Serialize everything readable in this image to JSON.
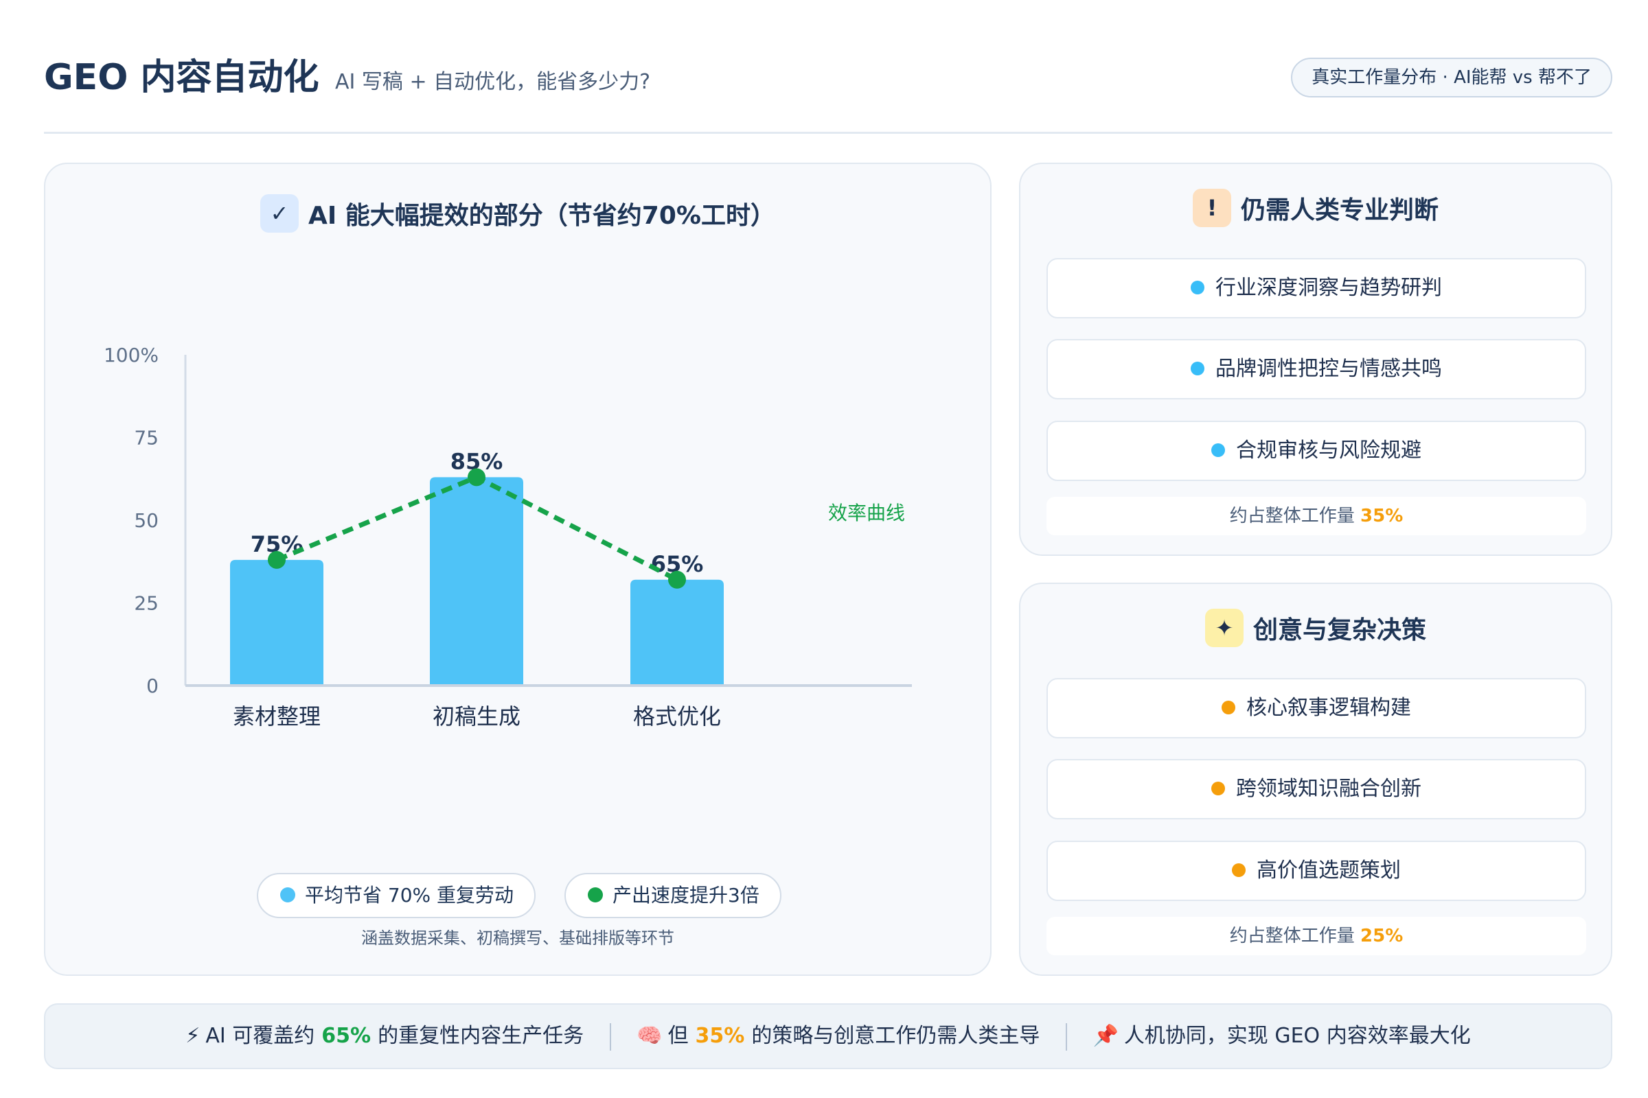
{
  "header": {
    "title": "GEO 内容自动化",
    "subtitle": "AI 写稿 + 自动优化，能省多少力?",
    "badge": "真实工作量分布 · AI能帮 vs 帮不了"
  },
  "left_panel": {
    "icon": "check-icon",
    "icon_glyph": "✓",
    "title": "AI 能大幅提效的部分（节省约70%工时）",
    "legend": [
      {
        "label": "平均节省 70% 重复劳动",
        "color": "#4fc3f7"
      },
      {
        "label": "产出速度提升3倍",
        "color": "#16a34a"
      }
    ],
    "note": "涵盖数据采集、初稿撰写、基础排版等环节"
  },
  "chart_data": {
    "type": "bar",
    "categories": [
      "素材整理",
      "初稿生成",
      "格式优化"
    ],
    "values": [
      38,
      63,
      32
    ],
    "data_labels": [
      "75%",
      "85%",
      "65%"
    ],
    "y_ticks": [
      "0",
      "25",
      "50",
      "75",
      "100%"
    ],
    "ylim": [
      0,
      100
    ],
    "bar_color": "#4fc3f7",
    "series": [
      {
        "name": "效率曲线",
        "values": [
          38,
          63,
          32
        ],
        "color": "#16a34a",
        "style": "dashed-line"
      }
    ],
    "grid": false,
    "legend": "right"
  },
  "right_panel_1": {
    "icon": "exclamation-icon",
    "icon_glyph": "!",
    "icon_bg": "#fde0c0",
    "title": "仍需人类专业判断",
    "dot_color": "#38bdf8",
    "items": [
      "行业深度洞察与趋势研判",
      "品牌调性把控与情感共鸣",
      "合规审核与风险规避"
    ],
    "share_prefix": "约占整体工作量",
    "share_value": "35%",
    "share_color": "#f59e0b"
  },
  "right_panel_2": {
    "icon": "sparkle-icon",
    "icon_glyph": "✦",
    "icon_bg": "#fdf0a8",
    "title": "创意与复杂决策",
    "dot_color": "#f59e0b",
    "items": [
      "核心叙事逻辑构建",
      "跨领域知识融合创新",
      "高价值选题策划"
    ],
    "share_prefix": "约占整体工作量",
    "share_value": "25%",
    "share_color": "#f59e0b"
  },
  "footer": {
    "part1_icon": "⚡",
    "part1_pre": "AI 可覆盖约",
    "part1_num": "65%",
    "part1_post": "的重复性内容生产任务",
    "part2_icon": "🧠",
    "part2_pre": "但",
    "part2_num": "35%",
    "part2_post": "的策略与创意工作仍需人类主导",
    "part3_icon": "📌",
    "part3_text": "人机协同，实现 GEO 内容效率最大化",
    "green": "#16a34a",
    "orange": "#f59e0b"
  }
}
